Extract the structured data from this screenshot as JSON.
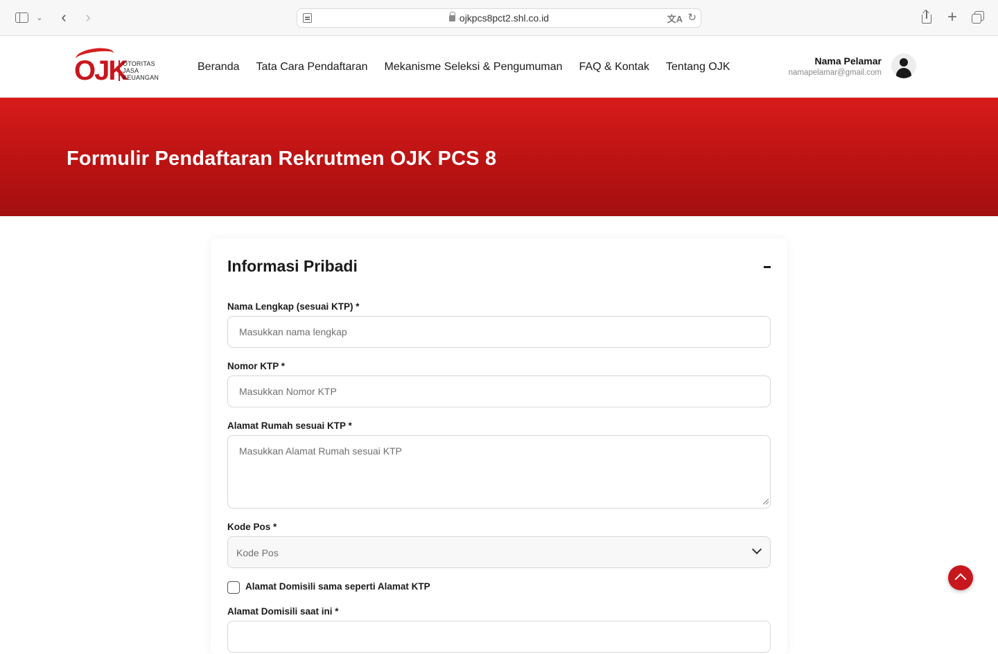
{
  "browser": {
    "url": "ojkpcs8pct2.shl.co.id",
    "icons": [
      "sidebar-icon",
      "chevron-down-icon",
      "back-icon",
      "forward-icon",
      "page-icon",
      "lock-icon",
      "translate-icon",
      "reload-icon",
      "share-icon",
      "plus-icon",
      "tabs-icon"
    ]
  },
  "header": {
    "logo": {
      "mark": "OJK",
      "line1": "OTORITAS",
      "line2": "JASA",
      "line3": "KEUANGAN"
    },
    "nav": [
      "Beranda",
      "Tata Cara Pendaftaran",
      "Mekanisme Seleksi & Pengumuman",
      "FAQ & Kontak",
      "Tentang OJK"
    ],
    "user": {
      "name": "Nama Pelamar",
      "email": "namapelamar@gmail.com"
    }
  },
  "hero": {
    "title": "Formulir Pendaftaran Rekrutmen OJK PCS 8"
  },
  "form": {
    "section_title": "Informasi Pribadi",
    "collapse_symbol": "–",
    "fields": {
      "nama": {
        "label": "Nama Lengkap (sesuai KTP) *",
        "placeholder": "Masukkan nama lengkap",
        "value": ""
      },
      "ktp": {
        "label": "Nomor KTP *",
        "placeholder": "Masukkan Nomor KTP",
        "value": ""
      },
      "alamat": {
        "label": "Alamat Rumah sesuai KTP *",
        "placeholder": "Masukkan Alamat Rumah sesuai KTP",
        "value": ""
      },
      "kodepos": {
        "label": "Kode Pos *",
        "selected": "Kode Pos"
      },
      "domisili_same": {
        "label": "Alamat Domisili sama seperti Alamat KTP",
        "checked": false
      },
      "domisili": {
        "label": "Alamat Domisili saat ini *"
      }
    }
  },
  "colors": {
    "brand_red": "#c8161d",
    "hero_top": "#d81b1b",
    "hero_bottom": "#a30f10"
  }
}
